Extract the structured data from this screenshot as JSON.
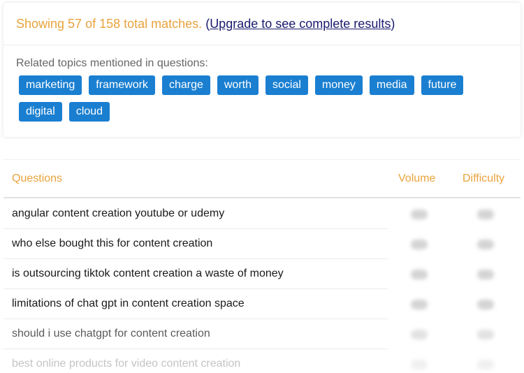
{
  "summary": {
    "prefix": "Showing 57 of 158 total matches.",
    "open_paren": "(",
    "link": "Upgrade to see complete results",
    "close_paren": ")"
  },
  "topics": {
    "label": "Related topics mentioned in questions:",
    "tags": [
      "marketing",
      "framework",
      "charge",
      "worth",
      "social",
      "money",
      "media",
      "future",
      "digital",
      "cloud"
    ]
  },
  "table": {
    "headers": {
      "questions": "Questions",
      "volume": "Volume",
      "difficulty": "Difficulty"
    },
    "rows": [
      "angular content creation youtube or udemy",
      "who else bought this for content creation",
      "is outsourcing tiktok content creation a waste of money",
      "limitations of chat gpt in content creation space",
      "should i use chatgpt for content creation",
      "best online products for video content creation"
    ]
  },
  "colors": {
    "accent_orange": "#e8a33d",
    "tag_blue": "#1a7fd1",
    "link_navy": "#1a1a6e"
  }
}
